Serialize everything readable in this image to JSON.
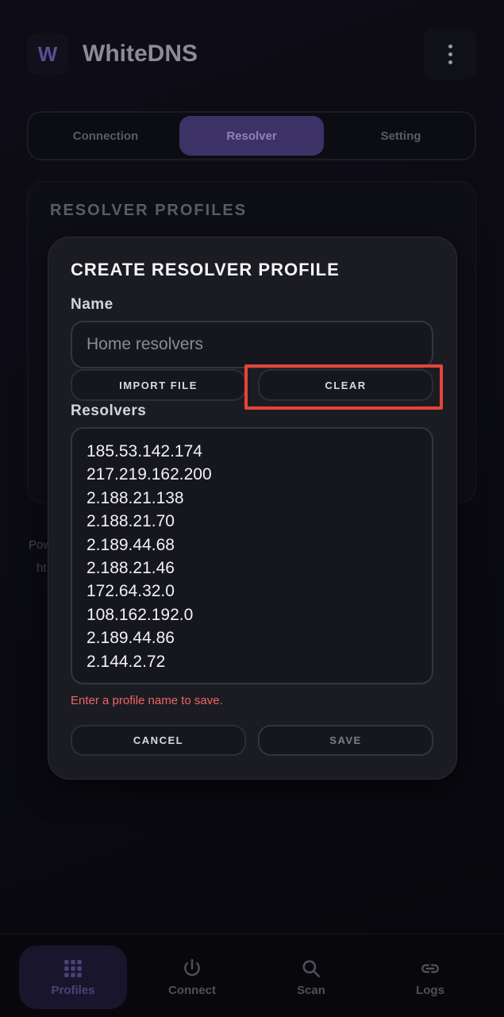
{
  "app": {
    "logo_letter": "W",
    "title": "WhiteDNS"
  },
  "tabs": [
    {
      "label": "Connection",
      "active": false
    },
    {
      "label": "Resolver",
      "active": true
    },
    {
      "label": "Setting",
      "active": false
    }
  ],
  "background_card": {
    "title": "RESOLVER PROFILES",
    "footer_fragment_1": "Pow",
    "footer_fragment_2": "ht"
  },
  "dialog": {
    "title": "CREATE RESOLVER PROFILE",
    "name_label": "Name",
    "name_value": "",
    "name_placeholder": "Home resolvers",
    "import_button": "IMPORT FILE",
    "clear_button": "CLEAR",
    "resolvers_label": "Resolvers",
    "resolvers": [
      "185.53.142.174",
      "217.219.162.200",
      "2.188.21.138",
      "2.188.21.70",
      "2.189.44.68",
      "2.188.21.46",
      "172.64.32.0",
      "108.162.192.0",
      "2.189.44.86",
      "2.144.2.72"
    ],
    "error_message": "Enter a profile name to save.",
    "cancel_button": "CANCEL",
    "save_button": "SAVE"
  },
  "bottom_nav": [
    {
      "label": "Profiles",
      "icon": "grid-icon",
      "active": true
    },
    {
      "label": "Connect",
      "icon": "power-icon",
      "active": false
    },
    {
      "label": "Scan",
      "icon": "search-icon",
      "active": false
    },
    {
      "label": "Logs",
      "icon": "link-icon",
      "active": false
    }
  ],
  "colors": {
    "accent": "#3d3266",
    "error": "#f06565",
    "highlight": "#e5453b"
  }
}
